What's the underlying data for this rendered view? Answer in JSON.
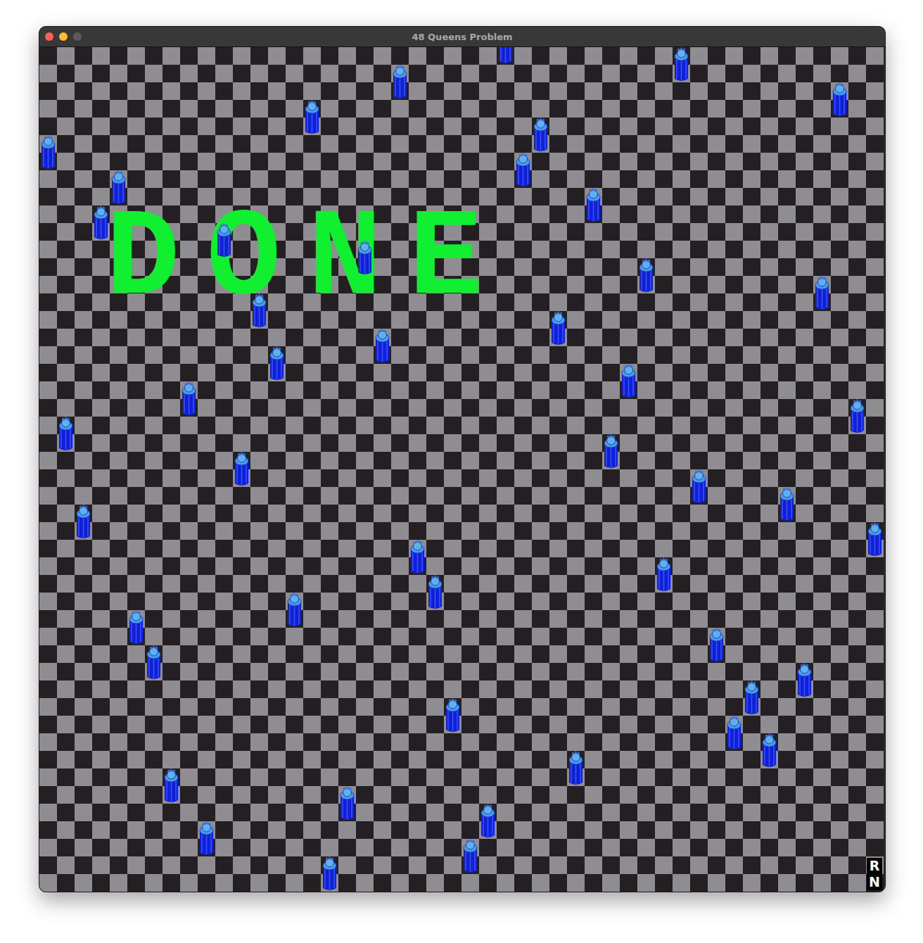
{
  "window": {
    "title": "48 Queens Problem"
  },
  "status": "DONE",
  "board": {
    "size": 48
  },
  "queens": [
    {
      "row": 0,
      "col": 26
    },
    {
      "row": 1,
      "col": 36
    },
    {
      "row": 2,
      "col": 20
    },
    {
      "row": 3,
      "col": 45
    },
    {
      "row": 4,
      "col": 15
    },
    {
      "row": 5,
      "col": 28
    },
    {
      "row": 6,
      "col": 0
    },
    {
      "row": 7,
      "col": 27
    },
    {
      "row": 8,
      "col": 4
    },
    {
      "row": 9,
      "col": 31
    },
    {
      "row": 10,
      "col": 3
    },
    {
      "row": 11,
      "col": 10
    },
    {
      "row": 12,
      "col": 18
    },
    {
      "row": 13,
      "col": 34
    },
    {
      "row": 14,
      "col": 44
    },
    {
      "row": 15,
      "col": 12
    },
    {
      "row": 16,
      "col": 29
    },
    {
      "row": 17,
      "col": 19
    },
    {
      "row": 18,
      "col": 13
    },
    {
      "row": 19,
      "col": 33
    },
    {
      "row": 20,
      "col": 8
    },
    {
      "row": 21,
      "col": 46
    },
    {
      "row": 22,
      "col": 1
    },
    {
      "row": 23,
      "col": 32
    },
    {
      "row": 24,
      "col": 11
    },
    {
      "row": 25,
      "col": 37
    },
    {
      "row": 26,
      "col": 42
    },
    {
      "row": 27,
      "col": 2
    },
    {
      "row": 28,
      "col": 47
    },
    {
      "row": 29,
      "col": 21
    },
    {
      "row": 30,
      "col": 35
    },
    {
      "row": 31,
      "col": 22
    },
    {
      "row": 32,
      "col": 14
    },
    {
      "row": 33,
      "col": 5
    },
    {
      "row": 34,
      "col": 38
    },
    {
      "row": 35,
      "col": 6
    },
    {
      "row": 36,
      "col": 43
    },
    {
      "row": 37,
      "col": 40
    },
    {
      "row": 38,
      "col": 23
    },
    {
      "row": 39,
      "col": 39
    },
    {
      "row": 40,
      "col": 41
    },
    {
      "row": 41,
      "col": 30
    },
    {
      "row": 42,
      "col": 7
    },
    {
      "row": 43,
      "col": 17
    },
    {
      "row": 44,
      "col": 25
    },
    {
      "row": 45,
      "col": 9
    },
    {
      "row": 46,
      "col": 24
    },
    {
      "row": 47,
      "col": 16
    }
  ],
  "corner_labels": [
    "R",
    "N"
  ]
}
